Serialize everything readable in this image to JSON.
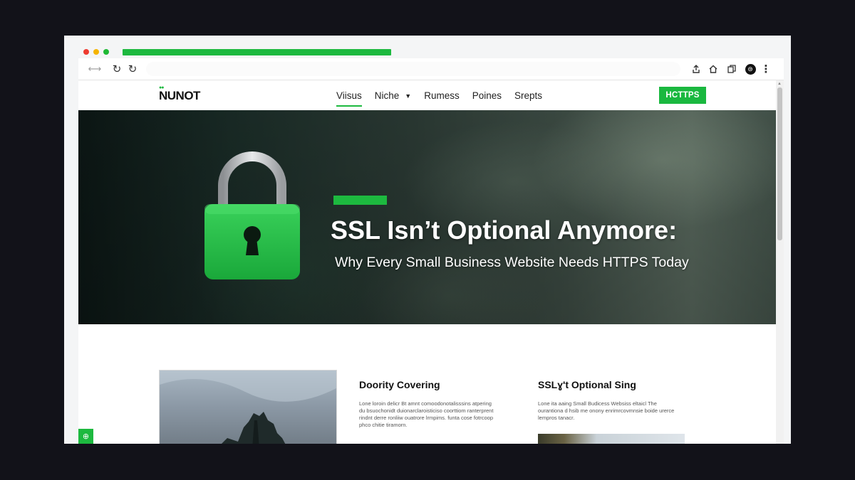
{
  "browser": {
    "url": "",
    "icons": {
      "nav": "back-forward-arrows-icon",
      "reload": "reload-icon",
      "share": "share-icon",
      "home": "home-icon",
      "copy": "copy-icon",
      "profile": "profile-icon",
      "menu": "menu-icon"
    },
    "page_load_progress": 0.37
  },
  "site": {
    "logo": "NUNOT",
    "nav": [
      {
        "label": "Viisus",
        "active": true
      },
      {
        "label": "Niche",
        "has_dropdown": true
      },
      {
        "label": "Rumess"
      },
      {
        "label": "Poines"
      },
      {
        "label": "Srepts"
      }
    ],
    "cta_label": "HCTTPS",
    "accent_color": "#1db93f"
  },
  "hero": {
    "title": "SSL Isn’t Optional Anymore:",
    "subtitle": "Why Every Small Business Website Needs HTTPS Today",
    "icon": "padlock-icon"
  },
  "cards": [
    {
      "title": "Doority Covering",
      "text": "Lone loroin delicr Bt amnt comoodonotalisssins atpering du bsuochonidt duionarclaroisticiso coorttiom ranterprent rindnt derre ronliiw ouatrore lrmpims. funta cose fotrcoop phco chitie tiramorn."
    },
    {
      "title": "SSLɣ't Optional Sing",
      "text": "Lone ita aaing Small Budicess Websiss eltaicl The ourantiona d hsib me onony enrimrcovmnsie boide urerce lempros tanacr."
    }
  ]
}
